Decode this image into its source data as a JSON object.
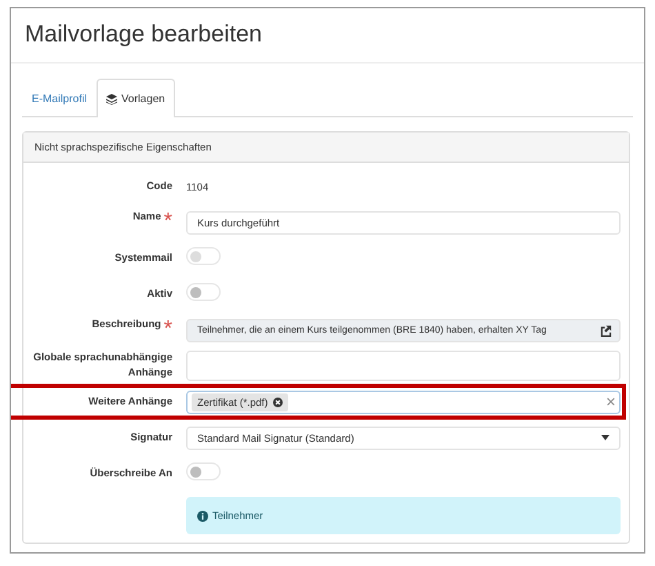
{
  "page_title": "Mailvorlage bearbeiten",
  "tabs": [
    {
      "label": "E-Mailprofil",
      "selected": false,
      "icon": false
    },
    {
      "label": "Vorlagen",
      "selected": true,
      "icon": true
    }
  ],
  "panel": {
    "heading": "Nicht sprachspezifische Eigenschaften",
    "fields": [
      {
        "kind": "static",
        "label": "Code",
        "value": "1104"
      },
      {
        "kind": "text",
        "label": "Name",
        "required_mark": "*",
        "value": "Kurs durchgeführt"
      },
      {
        "kind": "toggle",
        "label": "Systemmail",
        "on": false,
        "disabled": true
      },
      {
        "kind": "toggle",
        "label": "Aktiv",
        "on": false,
        "disabled": false
      },
      {
        "kind": "readonly",
        "label": "Beschreibung",
        "required_mark": "*",
        "value": "Teilnehmer, die an einem Kurs teilgenommen (BRE 1840) haben, erhalten XY Tag"
      },
      {
        "kind": "text",
        "label": "Globale sprachunabhängige Anhänge"
      },
      {
        "kind": "tags",
        "label": "Weitere Anhänge",
        "highlighted": true,
        "tags": [
          "Zertifikat (*.pdf)"
        ]
      },
      {
        "kind": "select",
        "label": "Signatur",
        "value": "Standard Mail Signatur (Standard)"
      },
      {
        "kind": "toggle",
        "label": "Überschreibe An",
        "on": false,
        "disabled": false
      },
      {
        "kind": "info",
        "text": "Teilnehmer"
      }
    ]
  }
}
